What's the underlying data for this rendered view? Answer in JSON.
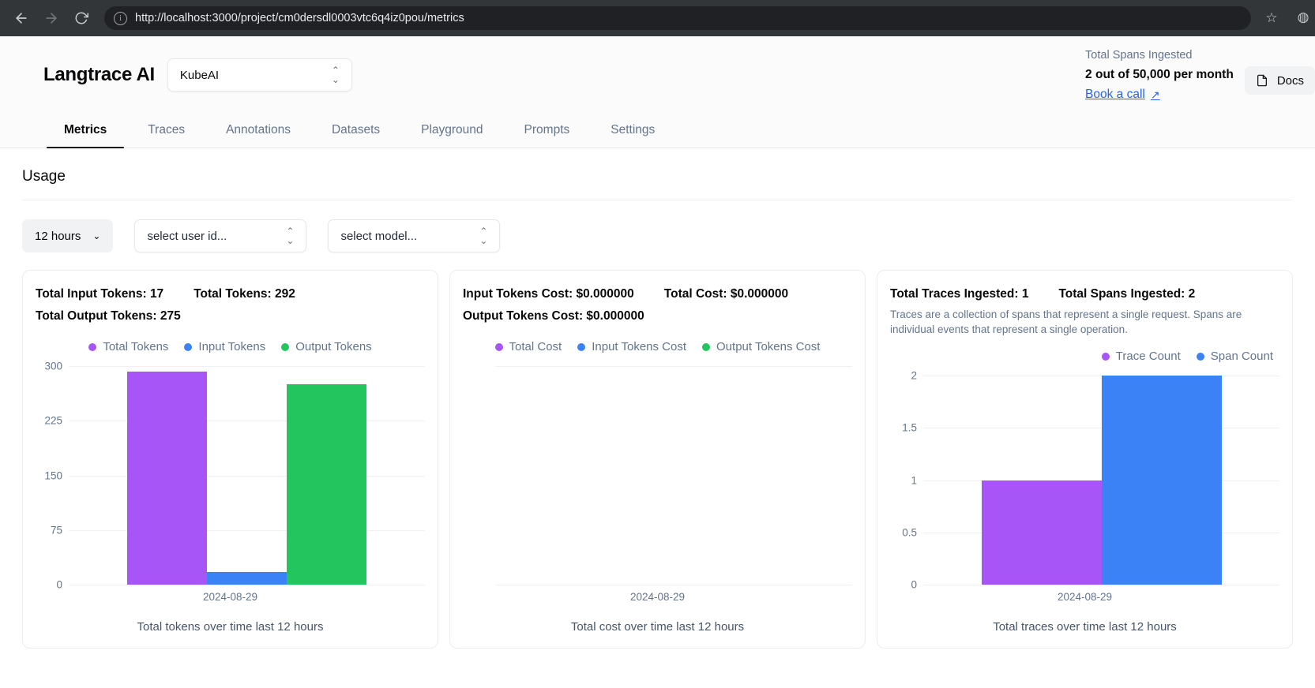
{
  "browser": {
    "back_icon": "arrow-left-icon",
    "forward_icon": "arrow-right-icon",
    "reload_icon": "reload-icon",
    "info_icon": "info-circle-icon",
    "url": "http://localhost:3000/project/cm0dersdl0003vtc6q4iz0pou/metrics",
    "bookmark_icon": "star-icon",
    "profile_icon": "profile-icon"
  },
  "header": {
    "brand": "Langtrace AI",
    "project_selected": "KubeAI",
    "project_chevron": "chevron-up-down-icon",
    "spans_label": "Total Spans Ingested",
    "spans_value": "2 out of 50,000 per month",
    "book_call": "Book a call",
    "book_call_arrow": "↗",
    "docs_label": "Docs",
    "docs_icon": "file-icon"
  },
  "tabs": [
    {
      "label": "Metrics",
      "active": true
    },
    {
      "label": "Traces",
      "active": false
    },
    {
      "label": "Annotations",
      "active": false
    },
    {
      "label": "Datasets",
      "active": false
    },
    {
      "label": "Playground",
      "active": false
    },
    {
      "label": "Prompts",
      "active": false
    },
    {
      "label": "Settings",
      "active": false
    }
  ],
  "main": {
    "section_title": "Usage"
  },
  "filters": {
    "time_range": "12 hours",
    "time_chevron": "chevron-down-icon",
    "user_placeholder": "select user id...",
    "model_placeholder": "select model...",
    "select_chevron": "chevron-up-down-icon"
  },
  "colors": {
    "purple": "#a855f7",
    "blue": "#3b82f6",
    "green": "#22c55e",
    "link": "#2563eb",
    "muted": "#64748b",
    "grid": "#f0f0f2"
  },
  "cards": [
    {
      "stats": [
        "Total Input Tokens: 17",
        "Total Tokens: 292",
        "Total Output Tokens: 275"
      ],
      "description": "",
      "caption": "Total tokens over time last 12 hours"
    },
    {
      "stats": [
        "Input Tokens Cost: $0.000000",
        "Total Cost: $0.000000",
        "Output Tokens Cost: $0.000000"
      ],
      "description": "",
      "caption": "Total cost over time last 12 hours"
    },
    {
      "stats": [
        "Total Traces Ingested: 1",
        "Total Spans Ingested: 2"
      ],
      "description": "Traces are a collection of spans that represent a single request. Spans are individual events that represent a single operation.",
      "caption": "Total traces over time last 12 hours"
    }
  ],
  "chart_data": [
    {
      "type": "bar",
      "title": "Total tokens over time last 12 hours",
      "categories": [
        "2024-08-29"
      ],
      "series": [
        {
          "name": "Total Tokens",
          "values": [
            292
          ],
          "color": "#a855f7"
        },
        {
          "name": "Input Tokens",
          "values": [
            17
          ],
          "color": "#3b82f6"
        },
        {
          "name": "Output Tokens",
          "values": [
            275
          ],
          "color": "#22c55e"
        }
      ],
      "xlabel": "",
      "ylabel": "",
      "ylim": [
        0,
        300
      ],
      "yticks": [
        300,
        225,
        150,
        75,
        0
      ],
      "grid": true,
      "legend_position": "top-center"
    },
    {
      "type": "bar",
      "title": "Total cost over time last 12 hours",
      "categories": [
        "2024-08-29"
      ],
      "series": [
        {
          "name": "Total Cost",
          "values": [
            0
          ],
          "color": "#a855f7"
        },
        {
          "name": "Input Tokens Cost",
          "values": [
            0
          ],
          "color": "#3b82f6"
        },
        {
          "name": "Output Tokens Cost",
          "values": [
            0
          ],
          "color": "#22c55e"
        }
      ],
      "xlabel": "",
      "ylabel": "",
      "ylim": [
        0,
        0
      ],
      "yticks": [],
      "grid": true,
      "legend_position": "top-center"
    },
    {
      "type": "bar",
      "title": "Total traces over time last 12 hours",
      "categories": [
        "2024-08-29"
      ],
      "series": [
        {
          "name": "Trace Count",
          "values": [
            1
          ],
          "color": "#a855f7"
        },
        {
          "name": "Span Count",
          "values": [
            2
          ],
          "color": "#3b82f6"
        }
      ],
      "xlabel": "",
      "ylabel": "",
      "ylim": [
        0,
        2
      ],
      "yticks": [
        2,
        1.5,
        1,
        0.5,
        0
      ],
      "grid": true,
      "legend_position": "top-right"
    }
  ]
}
